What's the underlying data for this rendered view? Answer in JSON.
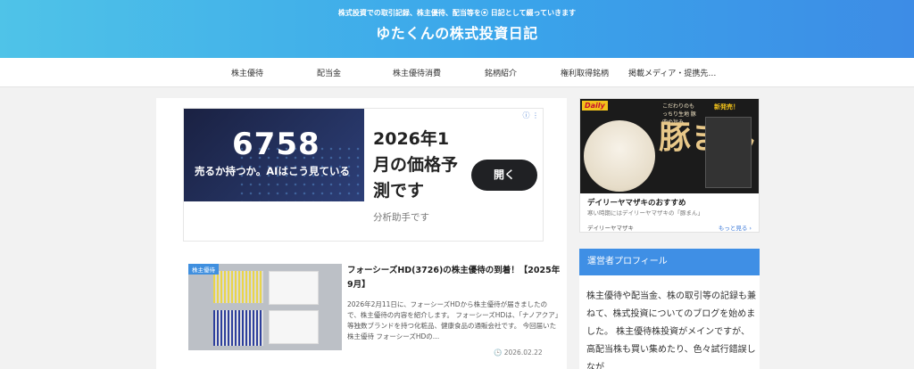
{
  "header": {
    "tagline": "株式投資での取引記録、株主優待、配当等を⦿ 日記として綴っていきます",
    "site_title": "ゆたくんの株式投資日記"
  },
  "nav": {
    "items": [
      "株主優待",
      "配当金",
      "株主優待消費",
      "銘柄紹介",
      "権利取得銘柄",
      "掲載メディア・提携先…"
    ]
  },
  "ad_banner": {
    "image_number": "6758",
    "image_subtitle": "売るか持つか。AIはこう見ている",
    "headline": "2026年1月の価格予測です",
    "cta_label": "開く",
    "advertiser": "分析助手です",
    "adchoices": "ⓘ ⋮"
  },
  "post": {
    "category": "株主優待",
    "title": "フォーシーズHD(3726)の株主優待の到着！【2025年9月】",
    "excerpt": "2026年2月11日に、フォーシーズHDから株主優待が届きましたので、株主優待の内容を紹介します。 フォーシーズHDは、「ナノアクア」等独数ブランドを持つ化粧品、健康食品の通販会社です。 今回届いた株主優待 フォーシーズHDの…",
    "date": "2026.02.22"
  },
  "sidebar_ad": {
    "brand": "Daily",
    "new_label": "新発売！",
    "image_copy": "こだわりのもっちり生地 豚肉の旨み",
    "image_kanji": "豚まん",
    "title": "デイリーヤマザキのおすすめ",
    "description": "寒い時期にはデイリーヤマザキの「豚まん」",
    "advertiser": "デイリーヤマザキ",
    "more_label": "もっと見る ›"
  },
  "profile": {
    "heading": "運営者プロフィール",
    "text": "株主優待や配当金、株の取引等の記録も兼ねて、株式投資についてのブログを始めました。 株主優待株投資がメインですが、高配当株も買い集めたり、色々試行錯誤しなが"
  }
}
